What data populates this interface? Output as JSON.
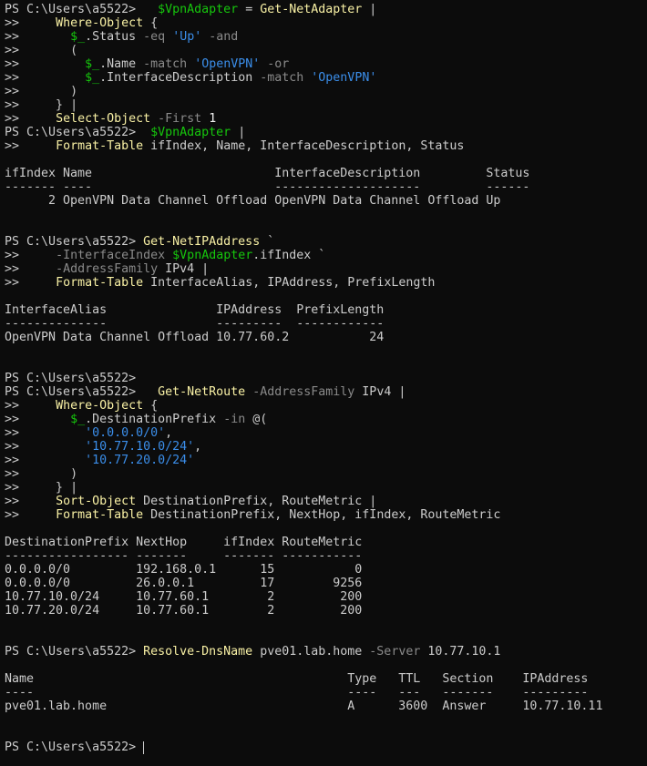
{
  "terminal": {
    "shell": "PowerShell",
    "prompt": "PS C:\\Users\\a5522> ",
    "continuation": ">> ",
    "lines": [
      [
        [
          "PS C:\\Users\\a5522> ",
          "default"
        ],
        [
          "  ",
          "default"
        ],
        [
          "$VpnAdapter",
          "var"
        ],
        [
          " = ",
          "default"
        ],
        [
          "Get-NetAdapter",
          "cmd"
        ],
        [
          " |",
          "default"
        ]
      ],
      [
        [
          ">> ",
          "default"
        ],
        [
          "    ",
          "default"
        ],
        [
          "Where-Object",
          "cmd"
        ],
        [
          " {",
          "default"
        ]
      ],
      [
        [
          ">> ",
          "default"
        ],
        [
          "      ",
          "default"
        ],
        [
          "$_",
          "var"
        ],
        [
          ".Status ",
          "default"
        ],
        [
          "-eq",
          "op"
        ],
        [
          " ",
          "default"
        ],
        [
          "'Up'",
          "str"
        ],
        [
          " ",
          "default"
        ],
        [
          "-and",
          "op"
        ]
      ],
      [
        [
          ">> ",
          "default"
        ],
        [
          "      (",
          "default"
        ]
      ],
      [
        [
          ">> ",
          "default"
        ],
        [
          "        ",
          "default"
        ],
        [
          "$_",
          "var"
        ],
        [
          ".Name ",
          "default"
        ],
        [
          "-match",
          "op"
        ],
        [
          " ",
          "default"
        ],
        [
          "'OpenVPN'",
          "str"
        ],
        [
          " ",
          "default"
        ],
        [
          "-or",
          "op"
        ]
      ],
      [
        [
          ">> ",
          "default"
        ],
        [
          "        ",
          "default"
        ],
        [
          "$_",
          "var"
        ],
        [
          ".InterfaceDescription ",
          "default"
        ],
        [
          "-match",
          "op"
        ],
        [
          " ",
          "default"
        ],
        [
          "'OpenVPN'",
          "str"
        ]
      ],
      [
        [
          ">> ",
          "default"
        ],
        [
          "      )",
          "default"
        ]
      ],
      [
        [
          ">> ",
          "default"
        ],
        [
          "    } |",
          "default"
        ]
      ],
      [
        [
          ">> ",
          "default"
        ],
        [
          "    ",
          "default"
        ],
        [
          "Select-Object",
          "cmd"
        ],
        [
          " ",
          "default"
        ],
        [
          "-First",
          "param"
        ],
        [
          " ",
          "default"
        ],
        [
          "1",
          "num"
        ]
      ],
      [
        [
          "PS C:\\Users\\a5522> ",
          "default"
        ],
        [
          " ",
          "default"
        ],
        [
          "$VpnAdapter",
          "var"
        ],
        [
          " |",
          "default"
        ]
      ],
      [
        [
          ">> ",
          "default"
        ],
        [
          "    ",
          "default"
        ],
        [
          "Format-Table",
          "cmd"
        ],
        [
          " ifIndex, Name, InterfaceDescription, Status",
          "default"
        ]
      ],
      [],
      [
        [
          "ifIndex Name                         InterfaceDescription         Status",
          "default"
        ]
      ],
      [
        [
          "------- ----                         --------------------         ------",
          "default"
        ]
      ],
      [
        [
          "      2 OpenVPN Data Channel Offload OpenVPN Data Channel Offload Up",
          "default"
        ]
      ],
      [],
      [],
      [
        [
          "PS C:\\Users\\a5522> ",
          "default"
        ],
        [
          "Get-NetIPAddress",
          "cmd"
        ],
        [
          " `",
          "default"
        ]
      ],
      [
        [
          ">> ",
          "default"
        ],
        [
          "    ",
          "default"
        ],
        [
          "-InterfaceIndex",
          "param"
        ],
        [
          " ",
          "default"
        ],
        [
          "$VpnAdapter",
          "var"
        ],
        [
          ".ifIndex `",
          "default"
        ]
      ],
      [
        [
          ">> ",
          "default"
        ],
        [
          "    ",
          "default"
        ],
        [
          "-AddressFamily",
          "param"
        ],
        [
          " IPv4 |",
          "default"
        ]
      ],
      [
        [
          ">> ",
          "default"
        ],
        [
          "    ",
          "default"
        ],
        [
          "Format-Table",
          "cmd"
        ],
        [
          " InterfaceAlias, IPAddress, PrefixLength",
          "default"
        ]
      ],
      [],
      [
        [
          "InterfaceAlias               IPAddress  PrefixLength",
          "default"
        ]
      ],
      [
        [
          "--------------               ---------  ------------",
          "default"
        ]
      ],
      [
        [
          "OpenVPN Data Channel Offload 10.77.60.2           24",
          "default"
        ]
      ],
      [],
      [],
      [
        [
          "PS C:\\Users\\a5522>",
          "default"
        ]
      ],
      [
        [
          "PS C:\\Users\\a5522> ",
          "default"
        ],
        [
          "  ",
          "default"
        ],
        [
          "Get-NetRoute",
          "cmd"
        ],
        [
          " ",
          "default"
        ],
        [
          "-AddressFamily",
          "param"
        ],
        [
          " IPv4 |",
          "default"
        ]
      ],
      [
        [
          ">> ",
          "default"
        ],
        [
          "    ",
          "default"
        ],
        [
          "Where-Object",
          "cmd"
        ],
        [
          " {",
          "default"
        ]
      ],
      [
        [
          ">> ",
          "default"
        ],
        [
          "      ",
          "default"
        ],
        [
          "$_",
          "var"
        ],
        [
          ".DestinationPrefix ",
          "default"
        ],
        [
          "-in",
          "op"
        ],
        [
          " @(",
          "default"
        ]
      ],
      [
        [
          ">> ",
          "default"
        ],
        [
          "        ",
          "default"
        ],
        [
          "'0.0.0.0/0'",
          "str"
        ],
        [
          ",",
          "default"
        ]
      ],
      [
        [
          ">> ",
          "default"
        ],
        [
          "        ",
          "default"
        ],
        [
          "'10.77.10.0/24'",
          "str"
        ],
        [
          ",",
          "default"
        ]
      ],
      [
        [
          ">> ",
          "default"
        ],
        [
          "        ",
          "default"
        ],
        [
          "'10.77.20.0/24'",
          "str"
        ]
      ],
      [
        [
          ">> ",
          "default"
        ],
        [
          "      )",
          "default"
        ]
      ],
      [
        [
          ">> ",
          "default"
        ],
        [
          "    } |",
          "default"
        ]
      ],
      [
        [
          ">> ",
          "default"
        ],
        [
          "    ",
          "default"
        ],
        [
          "Sort-Object",
          "cmd"
        ],
        [
          " DestinationPrefix, RouteMetric |",
          "default"
        ]
      ],
      [
        [
          ">> ",
          "default"
        ],
        [
          "    ",
          "default"
        ],
        [
          "Format-Table",
          "cmd"
        ],
        [
          " DestinationPrefix, NextHop, ifIndex, RouteMetric",
          "default"
        ]
      ],
      [],
      [
        [
          "DestinationPrefix NextHop     ifIndex RouteMetric",
          "default"
        ]
      ],
      [
        [
          "----------------- -------     ------- -----------",
          "default"
        ]
      ],
      [
        [
          "0.0.0.0/0         192.168.0.1      15           0",
          "default"
        ]
      ],
      [
        [
          "0.0.0.0/0         26.0.0.1         17        9256",
          "default"
        ]
      ],
      [
        [
          "10.77.10.0/24     10.77.60.1        2         200",
          "default"
        ]
      ],
      [
        [
          "10.77.20.0/24     10.77.60.1        2         200",
          "default"
        ]
      ],
      [],
      [],
      [
        [
          "PS C:\\Users\\a5522> ",
          "default"
        ],
        [
          "Resolve-DnsName",
          "cmd"
        ],
        [
          " pve01.lab.home ",
          "default"
        ],
        [
          "-Server",
          "param"
        ],
        [
          " 10.77.10.1",
          "default"
        ]
      ],
      [],
      [
        [
          "Name                                           Type   TTL   Section    IPAddress",
          "default"
        ]
      ],
      [
        [
          "----                                           ----   ---   -------    ---------",
          "default"
        ]
      ],
      [
        [
          "pve01.lab.home                                 A      3600  Answer     10.77.10.11",
          "default"
        ]
      ],
      [],
      [],
      [
        [
          "PS C:\\Users\\a5522> ",
          "default"
        ]
      ]
    ]
  },
  "colors": {
    "background": "#0c0c0c",
    "foreground": "#cccccc",
    "command": "#f9f1a5",
    "variable": "#16c60c",
    "string": "#3b8eea",
    "parameter": "#8a8a8a",
    "number": "#f2f2f2"
  }
}
